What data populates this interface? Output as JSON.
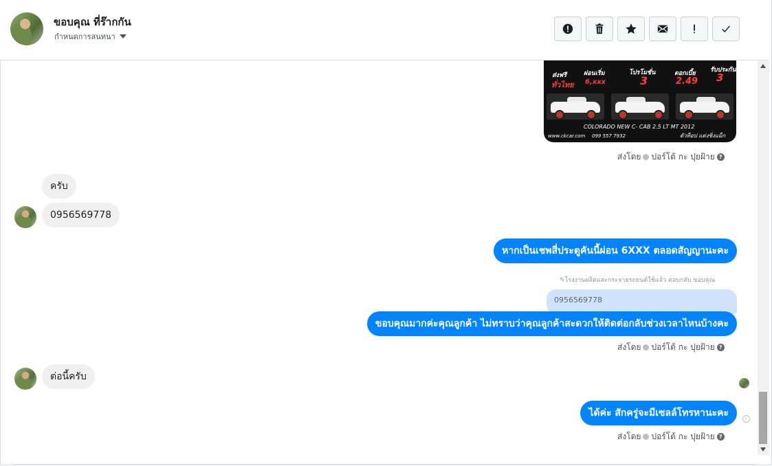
{
  "header": {
    "contact_name": "ขอบคุณ ที่ร๊ากกัน",
    "subtitle": "กำหนดการสนทนา",
    "toolbar_icons": [
      "alert-circle-icon",
      "trash-icon",
      "star-icon",
      "envelope-icon",
      "exclamation-icon",
      "check-icon"
    ]
  },
  "attachment": {
    "promos": [
      "ส่งฟรี",
      "ผ่อนเริ่ม",
      "โปรโมชั่น",
      "ดอกเบี้ย",
      "รับประกัน"
    ],
    "promo_values": [
      "ทั่วไทย",
      "6,xxx",
      "3",
      "2.49",
      "3"
    ],
    "model": "COLORADO NEW C- CAB 2.5 LT MT 2012",
    "footer_left": "www.ckcar.com",
    "footer_phone": "099 557 7932",
    "footer_right": "ตัวท็อป แต่งซิ่งแม็ก"
  },
  "sent_by": {
    "prefix": "ส่งโดย",
    "sender": "ปอร์โต้ กะ ปุยฝ้าย"
  },
  "messages": {
    "in_1": "ครับ",
    "in_2": "0956569778",
    "out_1": "หากเป็นเชพสี่ประตูคันนี้ผ่อน 6XXX ตลอดสัญญานะคะ",
    "reply_note": "โรงงานผลิตและกระจายรถยนต์ใช้แล้ว ตอบกลับ ขอบคุณ",
    "quoted": "0956569778",
    "out_2": "ขอบคุณมากค่ะคุณลูกค้า ไม่ทราบว่าคุณลูกค้าสะดวกให้ติดต่อกลับช่วงเวลาไหนบ้างคะ",
    "in_3": "ต่อนี้ครับ",
    "out_3": "ได้ค่ะ สักครู่จะมีเซลล์โทรหานะคะ"
  },
  "colors": {
    "outgoing_bubble": "#0084ff",
    "incoming_bubble": "#f1f0f0",
    "quoted_bubble": "#cfe3fb"
  }
}
